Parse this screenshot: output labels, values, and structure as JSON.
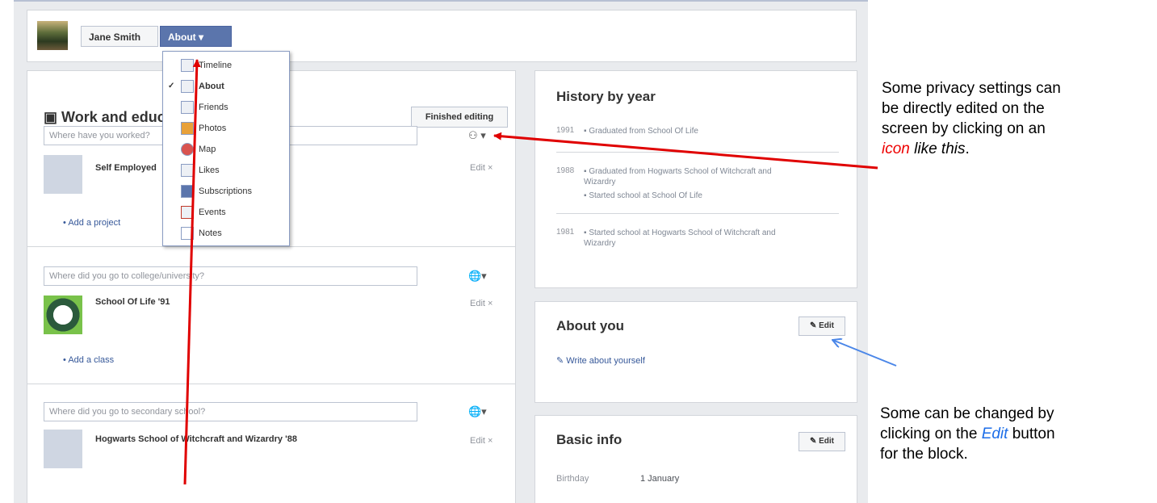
{
  "topbar": {
    "name_button": "Jane Smith",
    "about_button": "About ▾"
  },
  "dropdown": {
    "items": [
      {
        "label": "Timeline",
        "checked": false,
        "icon": "timeline-icon"
      },
      {
        "label": "About",
        "checked": true,
        "icon": "about-icon"
      },
      {
        "label": "Friends",
        "checked": false,
        "icon": "friends-icon"
      },
      {
        "label": "Photos",
        "checked": false,
        "icon": "photos-icon"
      },
      {
        "label": "Map",
        "checked": false,
        "icon": "map-pin-icon"
      },
      {
        "label": "Likes",
        "checked": false,
        "icon": "likes-icon"
      },
      {
        "label": "Subscriptions",
        "checked": false,
        "icon": "subscriptions-icon"
      },
      {
        "label": "Events",
        "checked": false,
        "icon": "calendar-icon"
      },
      {
        "label": "Notes",
        "checked": false,
        "icon": "notes-icon"
      }
    ]
  },
  "work": {
    "title": "Work and education",
    "finished_button": "Finished editing",
    "work_placeholder": "Where have you worked?",
    "employer": "Self Employed",
    "add_project": "Add a project",
    "college_placeholder": "Where did you go to college/university?",
    "college": "School Of Life '91",
    "add_class": "Add a class",
    "school_placeholder": "Where did you go to secondary school?",
    "school": "Hogwarts School of Witchcraft and Wizardry '88",
    "edit_label": "Edit",
    "close_mark": "×"
  },
  "history": {
    "title": "History by year",
    "rows": [
      {
        "year": "1991",
        "events": [
          "Graduated from School Of Life"
        ]
      },
      {
        "year": "1988",
        "events": [
          "Graduated from Hogwarts School of Witchcraft and Wizardry",
          "Started school at School Of Life"
        ]
      },
      {
        "year": "1981",
        "events": [
          "Started school at Hogwarts School of Witchcraft and Wizardry"
        ]
      }
    ]
  },
  "about_you": {
    "title": "About you",
    "edit_button": "✎ Edit",
    "write_link": "✎ Write about yourself"
  },
  "basic_info": {
    "title": "Basic info",
    "edit_button": "✎ Edit",
    "label": "Birthday",
    "value": "1 January"
  },
  "annotations": {
    "note1": {
      "line1": "Some privacy settings can",
      "line2": "be directly edited on the",
      "line3": "screen by clicking on an",
      "icon_word": "icon",
      "like_this": " like this",
      "period": "."
    },
    "note2": {
      "line1": "Some can be changed by",
      "line2_prefix": "clicking on the ",
      "edit_word": "Edit",
      "line2_suffix": " button",
      "line3": "for the block."
    }
  },
  "colors": {
    "arrow_red": "#e00000",
    "arrow_blue": "#4a86e8",
    "accent": "#5b75ac"
  }
}
